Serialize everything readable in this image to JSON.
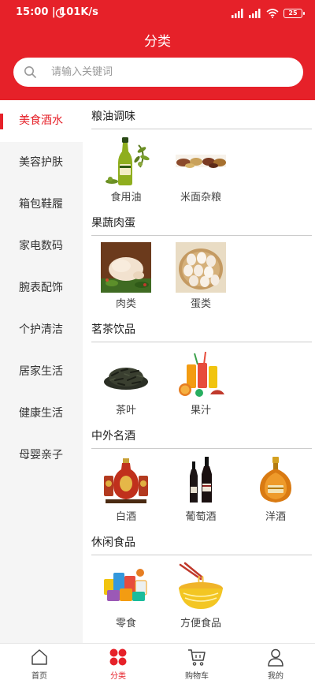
{
  "status_bar": {
    "time": "15:00 | 101K/s",
    "battery": "25"
  },
  "header": {
    "title": "分类"
  },
  "search": {
    "placeholder": "请输入关键词"
  },
  "sidebar": {
    "items": [
      {
        "label": "美食酒水",
        "active": true
      },
      {
        "label": "美容护肤"
      },
      {
        "label": "箱包鞋履"
      },
      {
        "label": "家电数码"
      },
      {
        "label": "腕表配饰"
      },
      {
        "label": "个护清洁"
      },
      {
        "label": "居家生活"
      },
      {
        "label": "健康生活"
      },
      {
        "label": "母婴亲子"
      }
    ]
  },
  "sections": [
    {
      "title": "粮油调味",
      "products": [
        {
          "label": "食用油"
        },
        {
          "label": "米面杂粮"
        }
      ]
    },
    {
      "title": "果蔬肉蛋",
      "products": [
        {
          "label": "肉类"
        },
        {
          "label": "蛋类"
        }
      ]
    },
    {
      "title": "茗茶饮品",
      "products": [
        {
          "label": "茶叶"
        },
        {
          "label": "果汁"
        }
      ]
    },
    {
      "title": "中外名酒",
      "products": [
        {
          "label": "白酒"
        },
        {
          "label": "葡萄酒"
        },
        {
          "label": "洋酒"
        }
      ]
    },
    {
      "title": "休闲食品",
      "products": [
        {
          "label": "零食"
        },
        {
          "label": "方便食品"
        }
      ]
    }
  ],
  "bottom_nav": {
    "items": [
      {
        "label": "首页"
      },
      {
        "label": "分类",
        "active": true
      },
      {
        "label": "购物车"
      },
      {
        "label": "我的"
      }
    ]
  },
  "colors": {
    "brand": "#e62129",
    "sidebar_bg": "#f5f5f5",
    "text": "#333333"
  }
}
